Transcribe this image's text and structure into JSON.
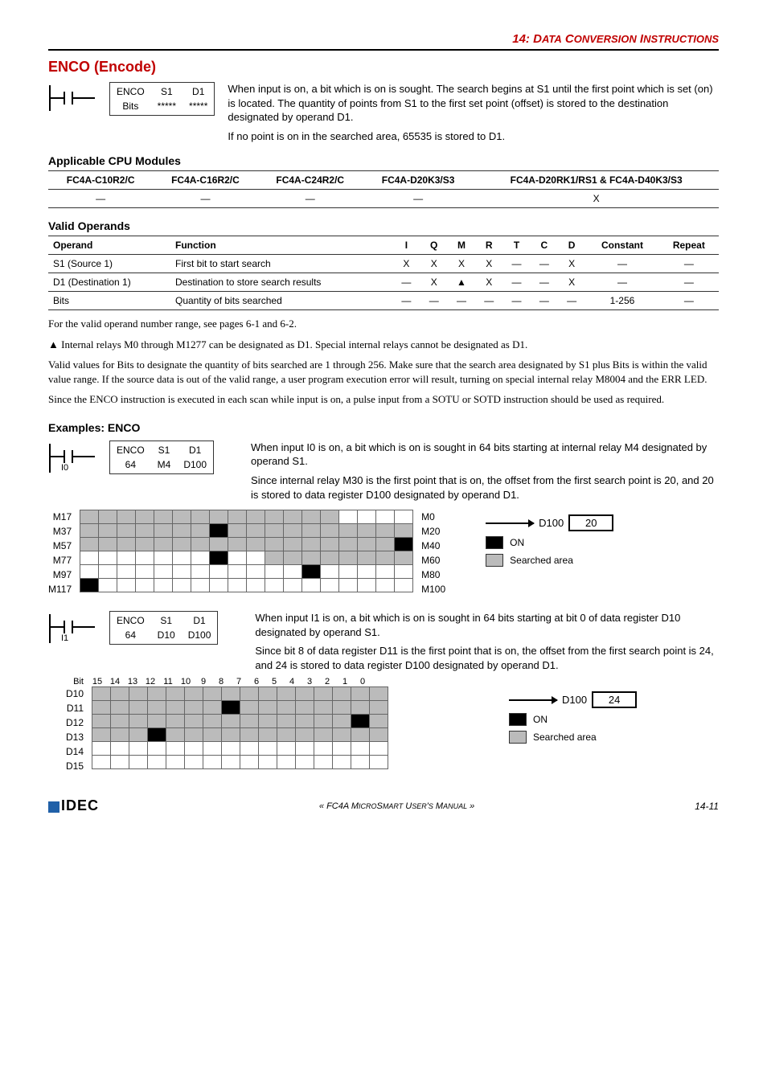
{
  "chapter": {
    "num": "14:",
    "title_pre": "D",
    "title_small": "ATA",
    "title_mid": " C",
    "title_small2": "ONVERSION",
    "title_post": " I",
    "title_small3": "NSTRUCTIONS"
  },
  "section_title": "ENCO (Encode)",
  "instr1": {
    "name": "ENCO",
    "bits": "Bits",
    "s1_label": "S1",
    "s1_val": "*****",
    "d1_label": "D1",
    "d1_val": "*****"
  },
  "desc1": "When input is on, a bit which is on is sought. The search begins at S1 until the first point which is set (on) is located. The quantity of points from S1 to the first set point (offset) is stored to the destination designated by operand D1.",
  "desc2": "If no point is on in the searched area, 65535 is stored to D1.",
  "applicable_title": "Applicable CPU Modules",
  "cpu": {
    "headers": [
      "FC4A-C10R2/C",
      "FC4A-C16R2/C",
      "FC4A-C24R2/C",
      "FC4A-D20K3/S3",
      "FC4A-D20RK1/RS1 & FC4A-D40K3/S3"
    ],
    "row": [
      "—",
      "—",
      "—",
      "—",
      "X"
    ]
  },
  "valid_operands_title": "Valid Operands",
  "ops": {
    "headers": [
      "Operand",
      "Function",
      "I",
      "Q",
      "M",
      "R",
      "T",
      "C",
      "D",
      "Constant",
      "Repeat"
    ],
    "rows": [
      {
        "operand": "S1 (Source 1)",
        "func": "First bit to start search",
        "cells": [
          "X",
          "X",
          "X",
          "X",
          "—",
          "—",
          "X",
          "—",
          "—"
        ]
      },
      {
        "operand": "D1 (Destination 1)",
        "func": "Destination to store search results",
        "cells": [
          "—",
          "X",
          "▲",
          "X",
          "—",
          "—",
          "X",
          "—",
          "—"
        ]
      },
      {
        "operand": "Bits",
        "func": "Quantity of bits searched",
        "cells": [
          "—",
          "—",
          "—",
          "—",
          "—",
          "—",
          "—",
          "1-256",
          "—"
        ]
      }
    ]
  },
  "para1": "For the valid operand number range, see pages 6-1 and 6-2.",
  "para2": "▲ Internal relays M0 through M1277 can be designated as D1. Special internal relays cannot be designated as D1.",
  "para3": "Valid values for Bits to designate the quantity of bits searched are 1 through 256. Make sure that the search area designated by S1 plus Bits is within the valid value range. If the source data is out of the valid range, a user program execution error will result, turning on special internal relay M8004 and the ERR LED.",
  "para4": "Since the ENCO instruction is executed in each scan while input is on, a pulse input from a SOTU or SOTD instruction should be used as required.",
  "examples_title": "Examples: ENCO",
  "ex1": {
    "input": "I0",
    "name": "ENCO",
    "bits": "64",
    "s1_label": "S1",
    "s1_val": "M4",
    "d1_label": "D1",
    "d1_val": "D100",
    "desc_a": "When input I0 is on, a bit which is on is sought in 64 bits starting at internal relay M4 designated by operand S1.",
    "desc_b": "Since internal relay M30 is the first point that is on, the offset from the first search point is 20, and 20 is stored to data register D100 designated by operand D1.",
    "row_labels_left": [
      "M17",
      "M37",
      "M57",
      "M77",
      "M97",
      "M117"
    ],
    "row_labels_right": [
      "M0",
      "M20",
      "M40",
      "M60",
      "M80",
      "M100"
    ],
    "result_label": "D100",
    "result_value": "20",
    "legend_on": "ON",
    "legend_sa": "Searched area"
  },
  "ex2": {
    "input": "I1",
    "name": "ENCO",
    "bits": "64",
    "s1_label": "S1",
    "s1_val": "D10",
    "d1_label": "D1",
    "d1_val": "D100",
    "desc_a": "When input I1 is on, a bit which is on is sought in 64 bits starting at bit 0 of data register D10 designated by operand S1.",
    "desc_b": "Since bit 8 of data register D11 is the first point that is on, the offset from the first search point is 24, and 24 is stored to data register D100 designated by operand D1.",
    "bit_label": "Bit",
    "bit_headers": [
      "15",
      "14",
      "13",
      "12",
      "11",
      "10",
      "9",
      "8",
      "7",
      "6",
      "5",
      "4",
      "3",
      "2",
      "1",
      "0"
    ],
    "row_labels_left": [
      "D10",
      "D11",
      "D12",
      "D13",
      "D14",
      "D15"
    ],
    "result_label": "D100",
    "result_value": "24",
    "legend_on": "ON",
    "legend_sa": "Searched area"
  },
  "footer": {
    "brand": "IDEC",
    "center_pre": "« FC4A M",
    "center_small1": "ICRO",
    "center_mid": "S",
    "center_small2": "MART",
    "center_mid2": " U",
    "center_small3": "SER",
    "center_mid3": "'",
    "center_small4": "S",
    "center_mid4": " M",
    "center_small5": "ANUAL",
    "center_post": " »",
    "page": "14-11"
  }
}
